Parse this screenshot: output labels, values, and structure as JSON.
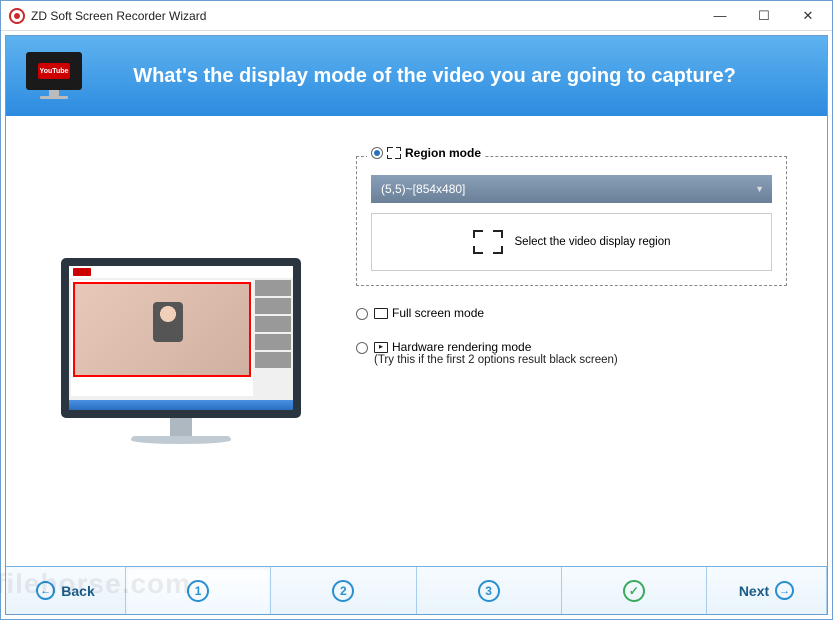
{
  "window": {
    "title": "ZD Soft Screen Recorder Wizard"
  },
  "banner": {
    "question": "What's the display mode of the video you are going to capture?",
    "monitor_badge": "YouTube"
  },
  "region": {
    "title": "Region mode",
    "dropdown_value": "(5,5)~[854x480]",
    "select_button": "Select the video display region"
  },
  "options": {
    "full_screen": "Full screen mode",
    "hardware": "Hardware rendering mode",
    "hardware_hint": "(Try this if the first 2 options result black screen)"
  },
  "footer": {
    "back": "Back",
    "next": "Next",
    "steps": [
      "1",
      "2",
      "3"
    ],
    "checkmark": "✓"
  },
  "watermark": "filehorse.com"
}
